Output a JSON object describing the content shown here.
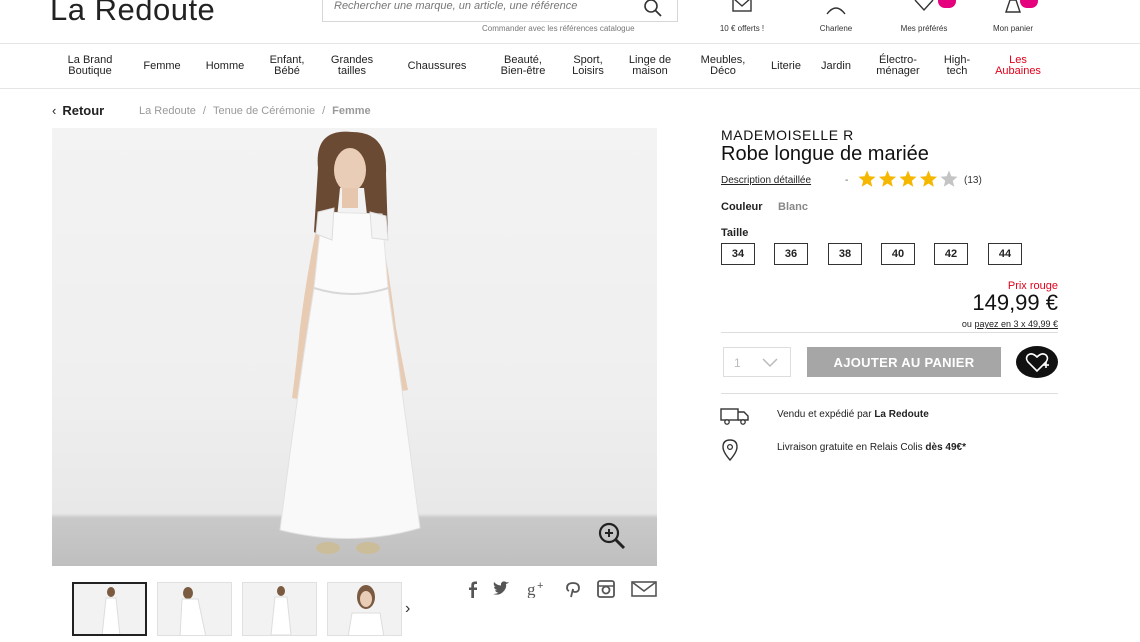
{
  "header": {
    "logo": "La Redoute",
    "search_placeholder": "Rechercher une marque, un article, une référence",
    "catalog_link": "Commander avec les références catalogue",
    "items": [
      {
        "label": "10 € offerts !",
        "icon": "envelope-icon"
      },
      {
        "label": "Charlene",
        "icon": "account-icon"
      },
      {
        "label": "Mes préférés",
        "icon": "heart-icon"
      },
      {
        "label": "Mon panier",
        "icon": "bag-icon"
      }
    ],
    "accent_color": "#e5007d"
  },
  "nav": {
    "items": [
      {
        "line1": "La Brand",
        "line2": "Boutique"
      },
      {
        "line1": "Femme",
        "line2": ""
      },
      {
        "line1": "Homme",
        "line2": ""
      },
      {
        "line1": "Enfant,",
        "line2": "Bébé"
      },
      {
        "line1": "Grandes",
        "line2": "tailles"
      },
      {
        "line1": "Chaussures",
        "line2": ""
      },
      {
        "line1": "Beauté,",
        "line2": "Bien-être"
      },
      {
        "line1": "Sport,",
        "line2": "Loisirs"
      },
      {
        "line1": "Linge de",
        "line2": "maison"
      },
      {
        "line1": "Meubles,",
        "line2": "Déco"
      },
      {
        "line1": "Literie",
        "line2": ""
      },
      {
        "line1": "Jardin",
        "line2": ""
      },
      {
        "line1": "Électro-",
        "line2": "ménager"
      },
      {
        "line1": "High-",
        "line2": "tech"
      },
      {
        "line1": "Les",
        "line2": "Aubaines"
      }
    ],
    "promo_color": "#e2001a"
  },
  "breadcrumb": {
    "back": "Retour",
    "items": [
      "La Redoute",
      "Tenue de Cérémonie",
      "Femme"
    ]
  },
  "product": {
    "brand": "MADEMOISELLE R",
    "name": "Robe longue de mariée",
    "description_link": "Description détaillée",
    "separator": "-",
    "rating": 4,
    "rating_max": 5,
    "rating_count": "(13)",
    "color_label": "Couleur",
    "color_value": "Blanc",
    "size_label": "Taille",
    "sizes": [
      "34",
      "36",
      "38",
      "40",
      "42",
      "44"
    ],
    "price_note": "Prix rouge",
    "price": "149,99 €",
    "installment_prefix": "ou",
    "installment_link": "payez en 3 x 49,99 €",
    "quantity": "1",
    "add_to_cart": "AJOUTER AU PANIER",
    "seller_prefix": "Vendu et expédié par",
    "seller_name": "La Redoute",
    "delivery_prefix": "Livraison gratuite en Relais Colis",
    "delivery_threshold": "dès 49€*"
  },
  "gallery": {
    "thumbnail_count": 4,
    "next": "›",
    "share": [
      "facebook-icon",
      "twitter-icon",
      "google-plus-icon",
      "pinterest-icon",
      "instagram-icon",
      "email-icon"
    ]
  }
}
